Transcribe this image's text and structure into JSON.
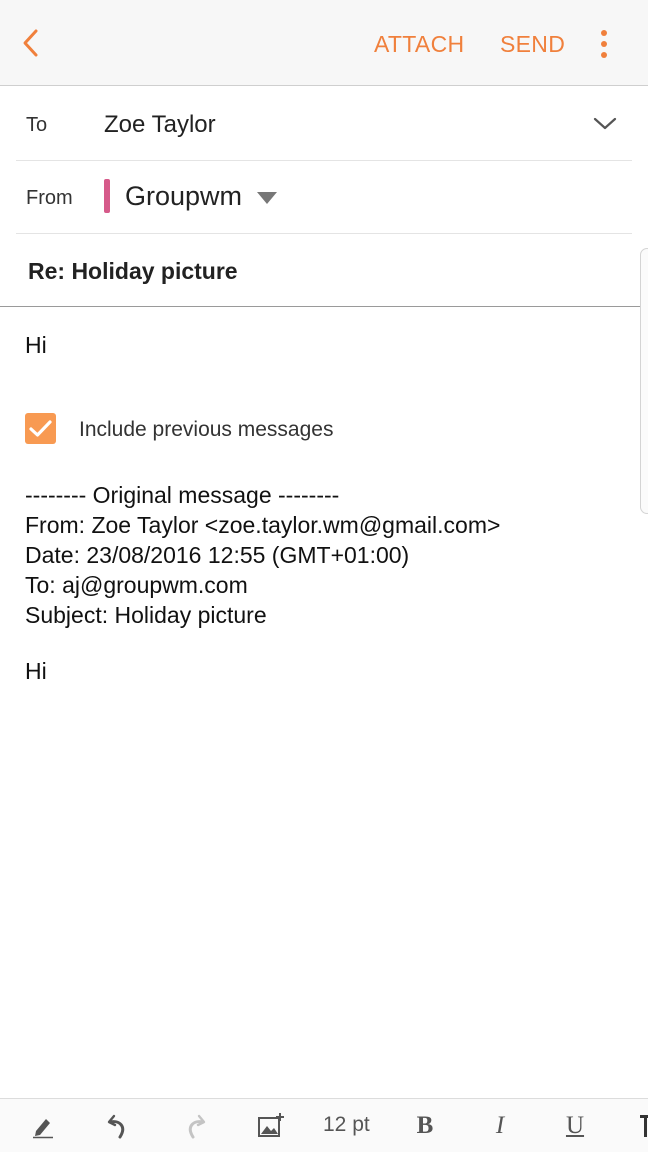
{
  "appbar": {
    "attach_label": "ATTACH",
    "send_label": "SEND",
    "accent": "#f0803c"
  },
  "to": {
    "label": "To",
    "value": "Zoe Taylor"
  },
  "from": {
    "label": "From",
    "value": "Groupwm",
    "account_color": "#d65a8a"
  },
  "subject": "Re: Holiday picture",
  "body": {
    "greeting": "Hi",
    "include_previous": {
      "label": "Include previous messages",
      "checked": true,
      "color": "#f89a52"
    },
    "quoted": {
      "separator": "-------- Original message --------",
      "from_line": "From: Zoe Taylor <zoe.taylor.wm@gmail.com>",
      "date_line": "Date: 23/08/2016 12:55 (GMT+01:00)",
      "to_line": "To: aj@groupwm.com",
      "subject_line": "Subject: Holiday picture",
      "greeting": "Hi"
    }
  },
  "toolbar": {
    "font_size": "12 pt",
    "bold": "B",
    "italic": "I",
    "underline": "U",
    "icons": [
      "pen-icon",
      "undo-icon",
      "redo-icon",
      "insert-image-icon"
    ]
  }
}
